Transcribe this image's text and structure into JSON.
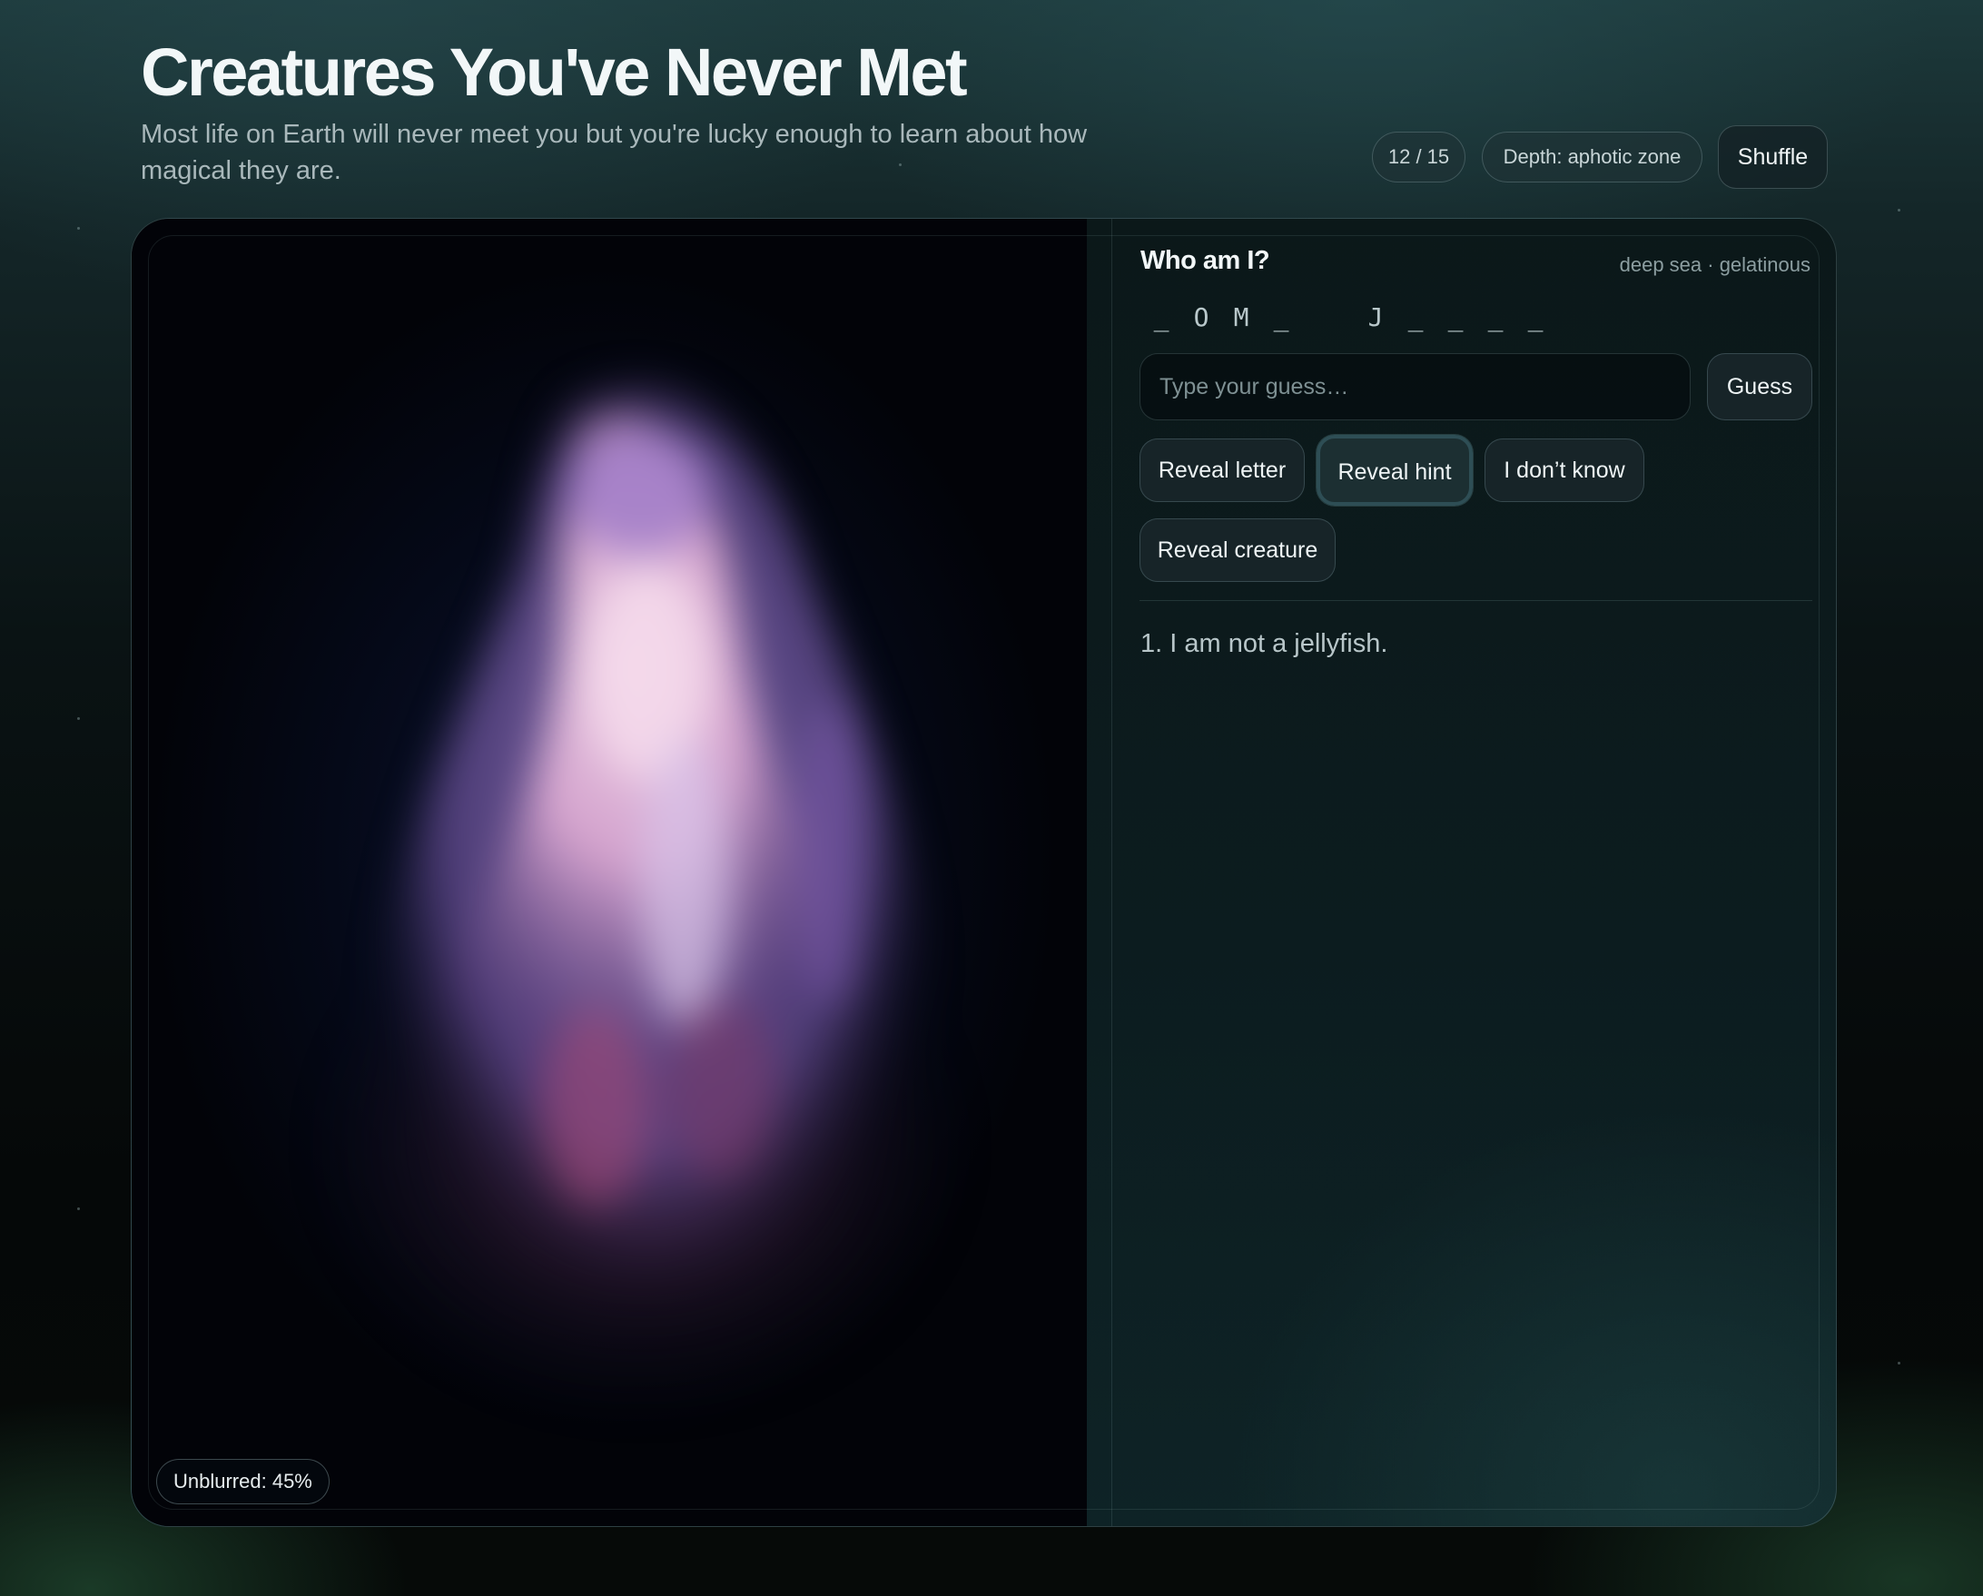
{
  "header": {
    "title": "Creatures You've Never Met",
    "subtitle": "Most life on Earth will never meet you but you're lucky enough to learn about how magical they are."
  },
  "status": {
    "progress": "12 / 15",
    "depth": "Depth: aphotic zone",
    "shuffle_label": "Shuffle"
  },
  "image_panel": {
    "unblurred_label": "Unblurred: 45%",
    "unblurred_fraction": 0.45
  },
  "quiz": {
    "heading": "Who am I?",
    "tags": "deep sea · gelatinous",
    "letter_slots": [
      "_",
      "O",
      "M",
      "_",
      " ",
      "J",
      "_",
      "_",
      "_",
      "_"
    ],
    "guess_placeholder": "Type your guess…",
    "guess_value": "",
    "guess_button": "Guess",
    "actions": {
      "reveal_letter": "Reveal letter",
      "reveal_hint": "Reveal hint",
      "dont_know": "I don’t know",
      "reveal_creature": "Reveal creature"
    },
    "hints": [
      "1. I am not a jellyfish."
    ]
  },
  "colors": {
    "background_top": "#1d3a3c",
    "background_bottom": "#060a08",
    "image_bg": "#050918",
    "creature_pink": "#f1c7e4",
    "creature_violet": "#8f6bb5"
  }
}
